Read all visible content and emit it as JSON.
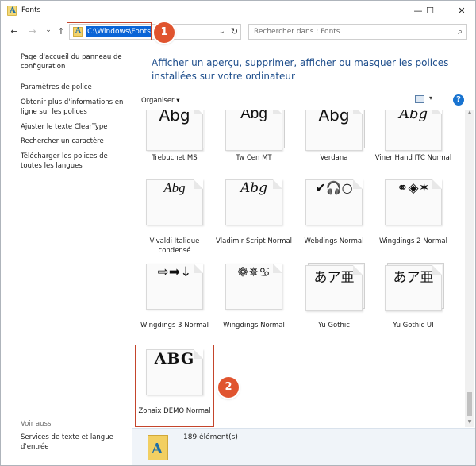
{
  "window": {
    "title": "Fonts",
    "minimize": "—",
    "maximize": "☐",
    "close": "✕"
  },
  "address": {
    "path": "C:\\Windows\\Fonts",
    "search_placeholder": "Rechercher dans : Fonts"
  },
  "nav": {
    "back": "←",
    "forward": "→",
    "dropdown": "⌄",
    "up": "↑",
    "refresh": "↻",
    "search_icon": "⌕"
  },
  "annotations": {
    "badge1": "1",
    "badge2": "2",
    "accent_color": "#e0542f"
  },
  "sidebar": {
    "items": [
      {
        "label": "Page d'accueil du panneau de configuration"
      },
      {
        "label": "Paramètres de police"
      },
      {
        "label": "Obtenir plus d'informations en ligne sur les polices"
      },
      {
        "label": "Ajuster le texte ClearType"
      },
      {
        "label": "Rechercher un caractère"
      },
      {
        "label": "Télécharger les polices de toutes les langues"
      }
    ],
    "see_also": "Voir aussi",
    "see_also_items": [
      {
        "label": "Services de texte et langue d'entrée"
      }
    ]
  },
  "header": {
    "text": "Afficher un aperçu, supprimer, afficher ou masquer les polices installées sur votre ordinateur"
  },
  "toolbar": {
    "organiser": "Organiser ▾",
    "view_dropdown": "▾",
    "help": "?"
  },
  "fonts": [
    {
      "sample": "Abg",
      "name": "Trebuchet MS",
      "stack": true
    },
    {
      "sample": "Abg",
      "name": "Tw Cen MT",
      "stack": true
    },
    {
      "sample": "Abg",
      "name": "Verdana",
      "stack": true
    },
    {
      "sample": "Abg",
      "name": "Viner Hand ITC Normal",
      "stack": false
    },
    {
      "sample": "Abg",
      "name": "Vivaldi Italique condensé",
      "stack": false
    },
    {
      "sample": "Abg",
      "name": "Vladimir Script Normal",
      "stack": false
    },
    {
      "sample": "✔🎧○",
      "name": "Webdings Normal",
      "stack": false
    },
    {
      "sample": "⚭◈✶",
      "name": "Wingdings 2 Normal",
      "stack": false
    },
    {
      "sample": "⇨➡↓",
      "name": "Wingdings 3 Normal",
      "stack": false
    },
    {
      "sample": "❁✵♋",
      "name": "Wingdings Normal",
      "stack": false
    },
    {
      "sample": "あア亜",
      "name": "Yu Gothic",
      "stack": true
    },
    {
      "sample": "あア亜",
      "name": "Yu Gothic UI",
      "stack": true
    },
    {
      "sample": "ABG",
      "name": "Zonaix DEMO Normal",
      "stack": false
    }
  ],
  "details": {
    "count": "189 élément(s)"
  }
}
